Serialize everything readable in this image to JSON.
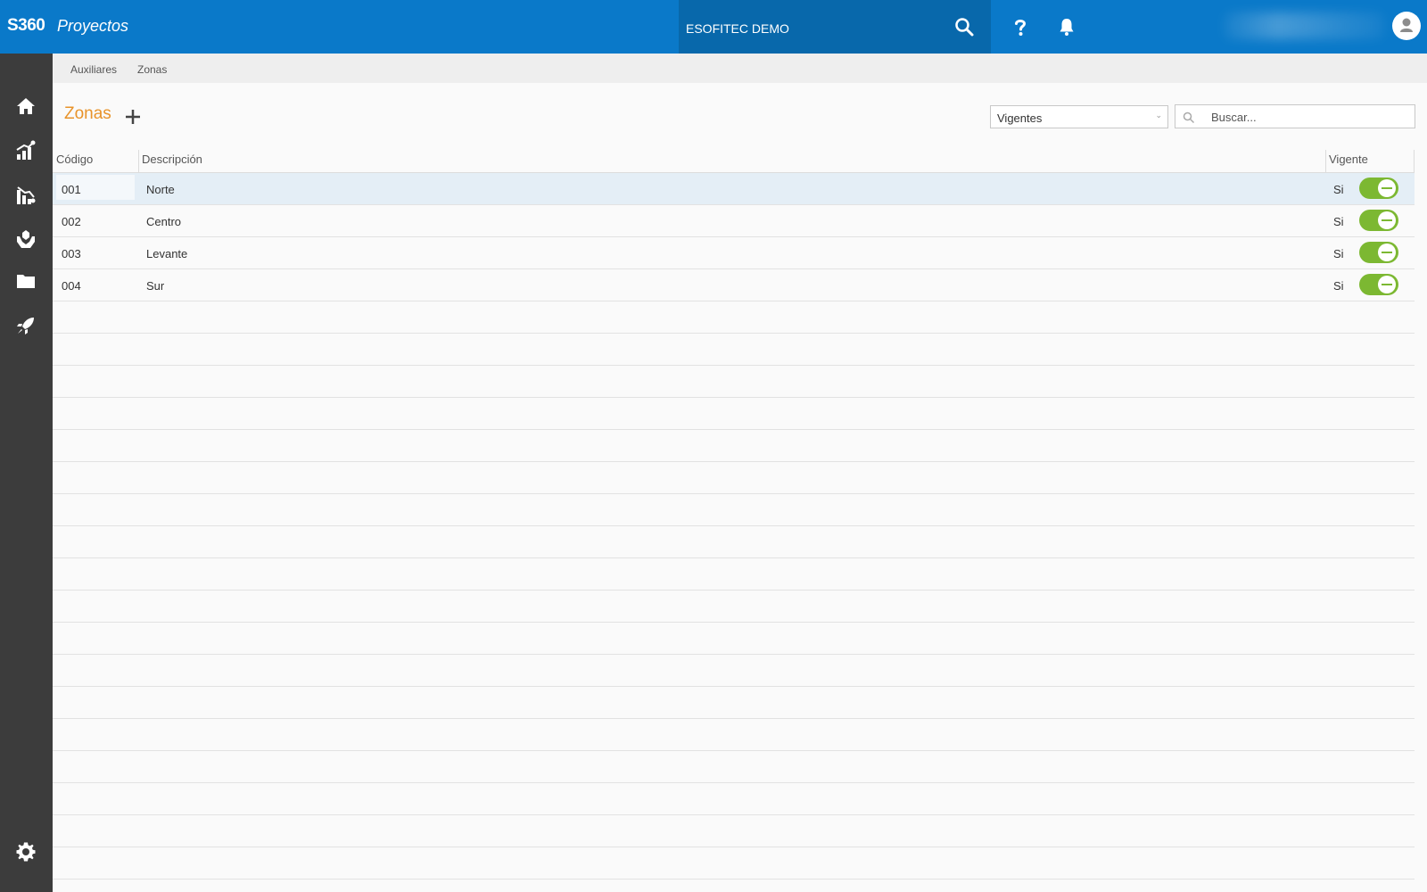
{
  "header": {
    "brand": "S360",
    "app_name": "Proyectos",
    "company": "ESOFITEC DEMO"
  },
  "breadcrumb": [
    "Auxiliares",
    "Zonas"
  ],
  "page": {
    "title": "Zonas",
    "filter_value": "Vigentes",
    "search_placeholder": "Buscar..."
  },
  "table": {
    "columns": [
      "Código",
      "Descripción",
      "Vigente"
    ],
    "rows": [
      {
        "code": "001",
        "description": "Norte",
        "vigente": "Si",
        "active": true
      },
      {
        "code": "002",
        "description": "Centro",
        "vigente": "Si",
        "active": true
      },
      {
        "code": "003",
        "description": "Levante",
        "vigente": "Si",
        "active": true
      },
      {
        "code": "004",
        "description": "Sur",
        "vigente": "Si",
        "active": true
      }
    ]
  },
  "sidebar": {
    "icons": [
      "home-icon",
      "chart-growth-icon",
      "chart-decline-icon",
      "hands-care-icon",
      "folder-icon",
      "rocket-icon",
      "gear-icon"
    ]
  },
  "colors": {
    "topbar": "#0a79c9",
    "company_bg": "#0868ab",
    "sidebar": "#3c3c3c",
    "title_accent": "#e8932a",
    "toggle_on": "#7cb832",
    "selected_row": "#e4eef6"
  }
}
